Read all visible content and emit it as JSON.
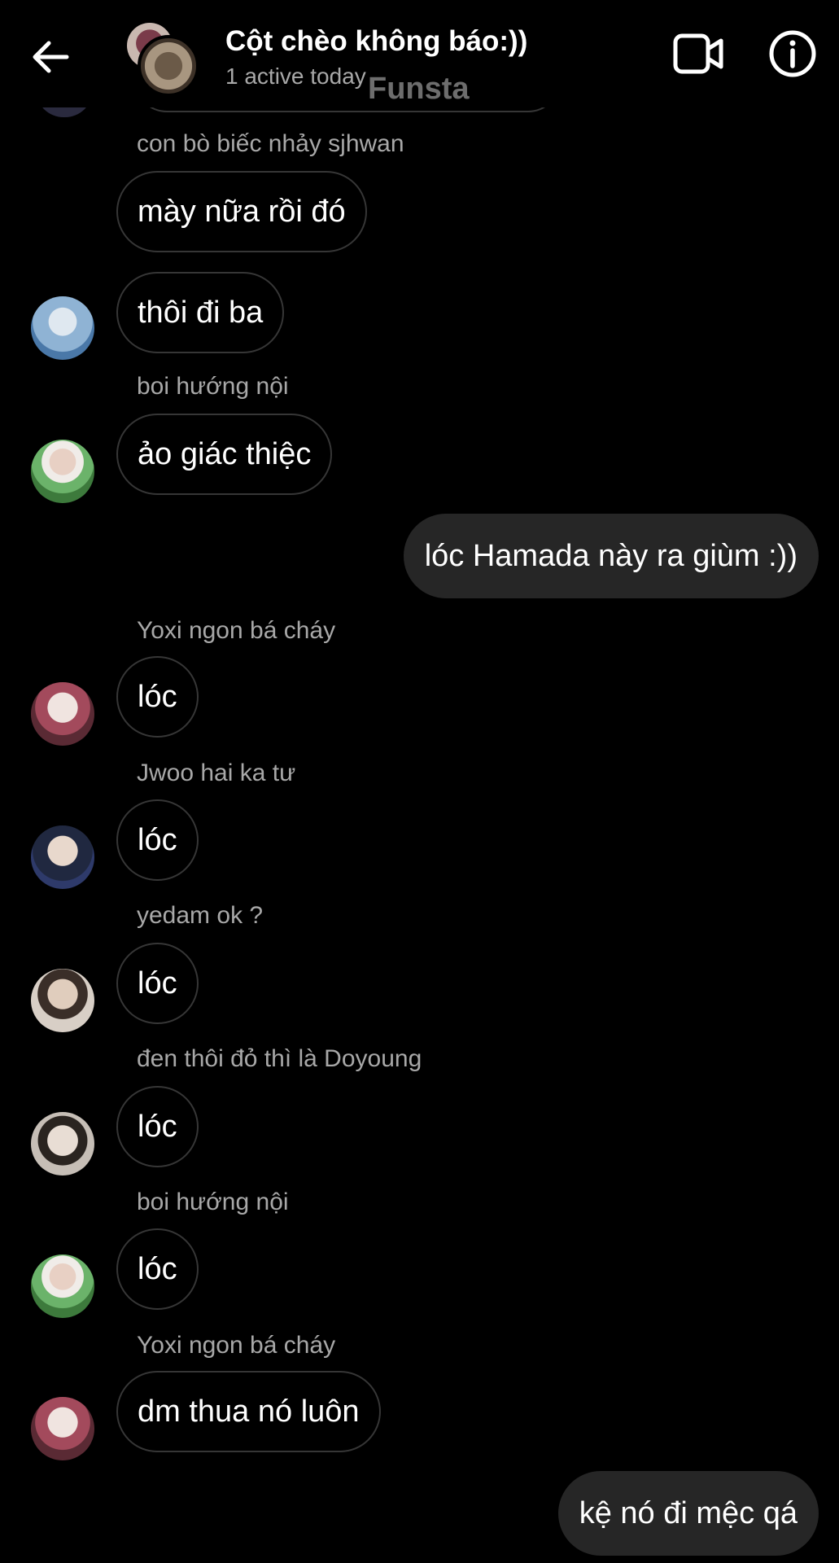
{
  "header": {
    "title": "Cột chèo không báo:))",
    "status": "1 active today",
    "watermark": "Funsta"
  },
  "icons": {
    "back": "arrow-left-icon",
    "video": "video-camera-icon",
    "info": "info-circle-icon"
  },
  "messages": [
    {
      "sender": "con bò biếc nhảy sjhwan",
      "text": "mày nữa rồi đó"
    },
    {
      "sender": "",
      "text": "thôi đi ba"
    },
    {
      "sender": "boi hướng nội",
      "text": "ảo giác thiệc"
    },
    {
      "sender": "",
      "text": "lóc Hamada này ra giùm :))",
      "outgoing": true
    },
    {
      "sender": "Yoxi ngon bá cháy",
      "text": "lóc"
    },
    {
      "sender": "Jwoo hai ka tư",
      "text": "lóc"
    },
    {
      "sender": "yedam ok ?",
      "text": "lóc"
    },
    {
      "sender": "đen thôi đỏ thì là Doyoung",
      "text": "lóc"
    },
    {
      "sender": "boi hướng nội",
      "text": "lóc"
    },
    {
      "sender": "Yoxi ngon bá cháy",
      "text": "dm thua nó luôn"
    },
    {
      "sender": "",
      "text": "kệ nó đi mệc qá",
      "outgoing": true
    }
  ],
  "colors": {
    "background": "#000000",
    "outgoing_bubble": "#262626",
    "incoming_border": "#363636",
    "secondary_text": "#a8a8a8"
  }
}
